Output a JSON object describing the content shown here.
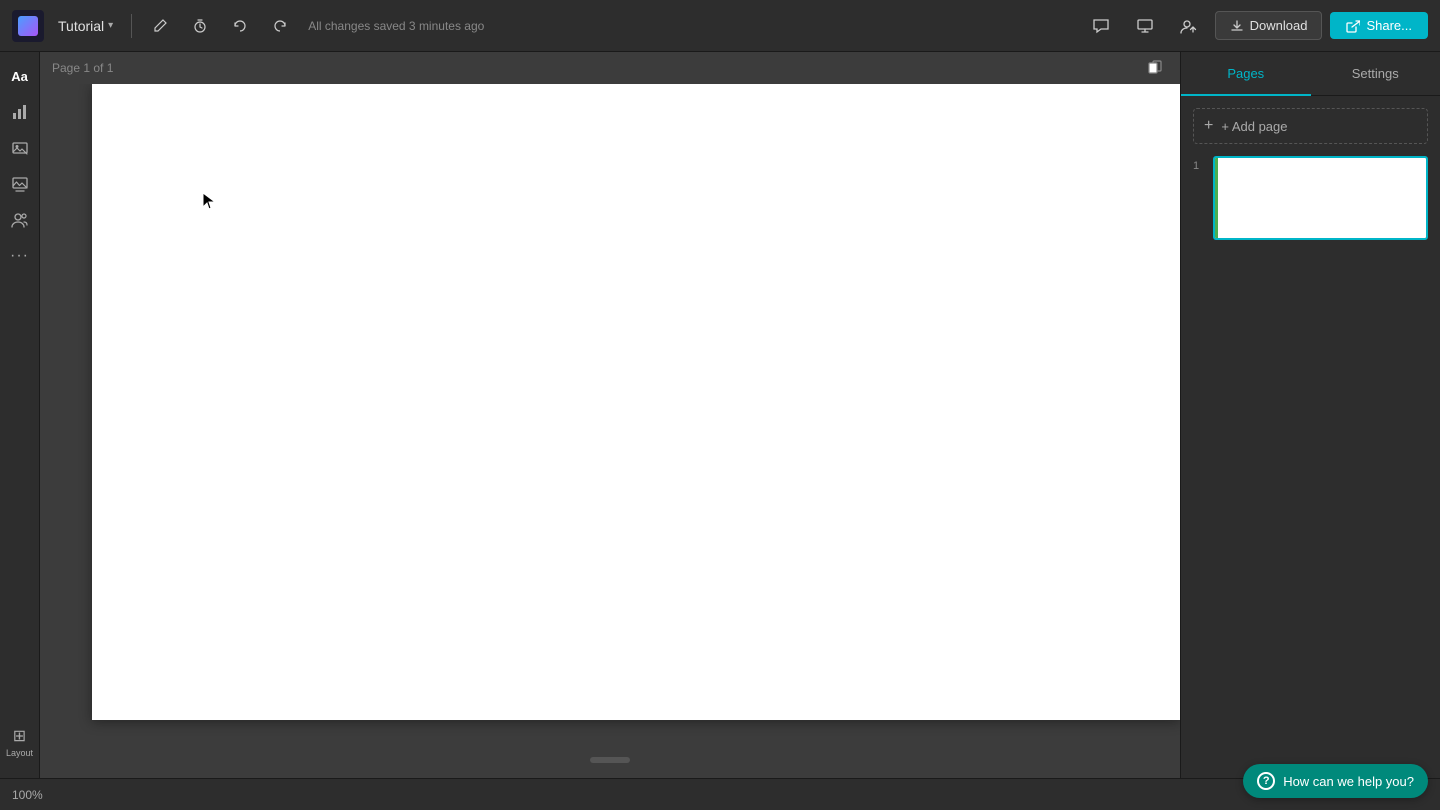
{
  "app": {
    "logo_label": "Visme",
    "title": "Tutorial",
    "autosave_text": "All changes saved 3 minutes ago",
    "zoom_level": "100%",
    "page_indicator": "Page 1 of 1"
  },
  "toolbar": {
    "edit_label": "✏",
    "timer_label": "⏱",
    "undo_label": "↩",
    "redo_label": "↪",
    "download_label": "Download",
    "share_label": "Share..."
  },
  "sidebar": {
    "items": [
      {
        "id": "text-icon",
        "label": "Aa"
      },
      {
        "id": "chart-icon",
        "label": "📊"
      },
      {
        "id": "media-icon",
        "label": "🖼"
      },
      {
        "id": "photo-icon",
        "label": "🏞"
      },
      {
        "id": "users-icon",
        "label": "👥"
      },
      {
        "id": "more-icon",
        "label": "..."
      }
    ],
    "layout_label": "Layout"
  },
  "right_panel": {
    "tabs": [
      {
        "id": "pages",
        "label": "Pages"
      },
      {
        "id": "settings",
        "label": "Settings"
      }
    ],
    "active_tab": "pages",
    "add_page_label": "+ Add page",
    "pages": [
      {
        "number": "1"
      }
    ]
  },
  "help": {
    "label": "How can we help you?"
  }
}
